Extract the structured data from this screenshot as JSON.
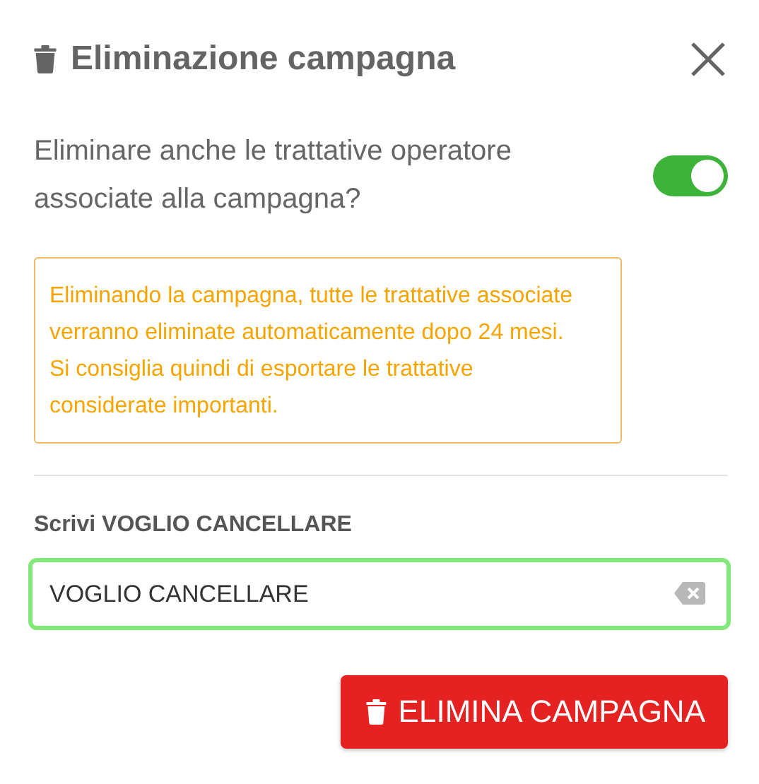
{
  "dialog": {
    "title": "Eliminazione campagna"
  },
  "option": {
    "label": "Eliminare anche le trattative operatore associate alla campagna?",
    "on": true
  },
  "warning": "Eliminando la campagna, tutte le trattative associate verranno eliminate automaticamente dopo 24 mesi. Si consiglia quindi di esportare le trattative considerate importanti.",
  "confirm": {
    "label": "Scrivi VOGLIO CANCELLARE",
    "value": "VOGLIO CANCELLARE"
  },
  "buttons": [
    {
      "label": "ELIMINA CAMPAGNA",
      "kind": "danger"
    }
  ]
}
